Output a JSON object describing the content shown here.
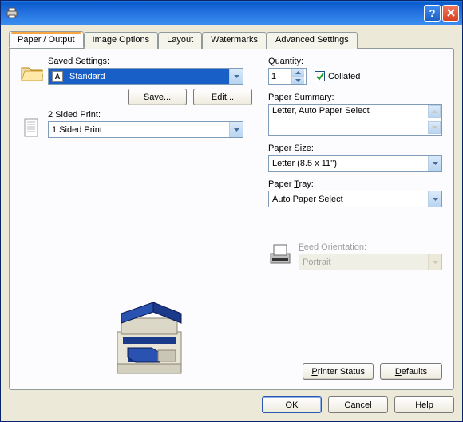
{
  "tabs": {
    "paper_output": "Paper / Output",
    "image_options": "Image Options",
    "layout": "Layout",
    "watermarks": "Watermarks",
    "advanced_settings": "Advanced Settings"
  },
  "left": {
    "saved_settings_label": "Saved Settings:",
    "saved_settings_value": "Standard",
    "save_btn": "Save...",
    "edit_btn": "Edit...",
    "two_sided_label": "2 Sided Print:",
    "two_sided_value": "1 Sided Print"
  },
  "right": {
    "quantity_label": "Quantity:",
    "quantity_value": "1",
    "collated_label": "Collated",
    "paper_summary_label": "Paper Summary:",
    "paper_summary_value": "Letter, Auto Paper Select",
    "paper_size_label": "Paper Size:",
    "paper_size_value": "Letter (8.5 x 11'')",
    "paper_tray_label": "Paper Tray:",
    "paper_tray_value": "Auto Paper Select",
    "feed_orientation_label": "Feed Orientation:",
    "feed_orientation_value": "Portrait"
  },
  "buttons": {
    "printer_status": "Printer Status",
    "defaults": "Defaults",
    "ok": "OK",
    "cancel": "Cancel",
    "help": "Help"
  },
  "underlines": {
    "saved": "v",
    "quantity": "Q",
    "collated": "l",
    "summary": "y",
    "size": "z",
    "tray": "T",
    "feed": "F",
    "save_btn": "S",
    "edit_btn": "E",
    "printer_status": "P",
    "defaults": "D"
  }
}
